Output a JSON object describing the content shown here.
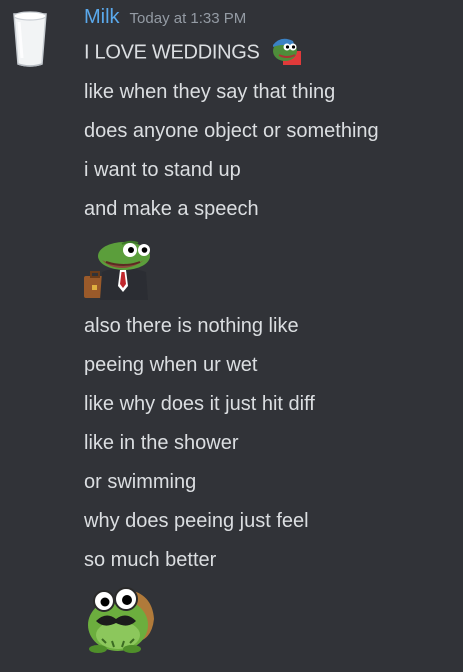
{
  "message": {
    "username": "Milk",
    "timestamp": "Today at 1:33 PM",
    "avatar_icon": "milk-glass-icon",
    "name_color": "#5aa9ec",
    "lines_part1": [
      "I LOVE WEDDINGS",
      "like when they say that thing",
      "does anyone object or something",
      "i want to stand up",
      "and make a speech"
    ],
    "inline_emoji_1": "pepe-cowboy-emoji",
    "emoji_2": "pepe-businessman-emoji",
    "lines_part2": [
      "also there is nothing like",
      "peeing when ur wet",
      "like why does it just hit diff",
      "like in the shower",
      "or swimming",
      "why does peeing just feel",
      "so much better"
    ],
    "emoji_3": "frog-mustache-emoji"
  }
}
